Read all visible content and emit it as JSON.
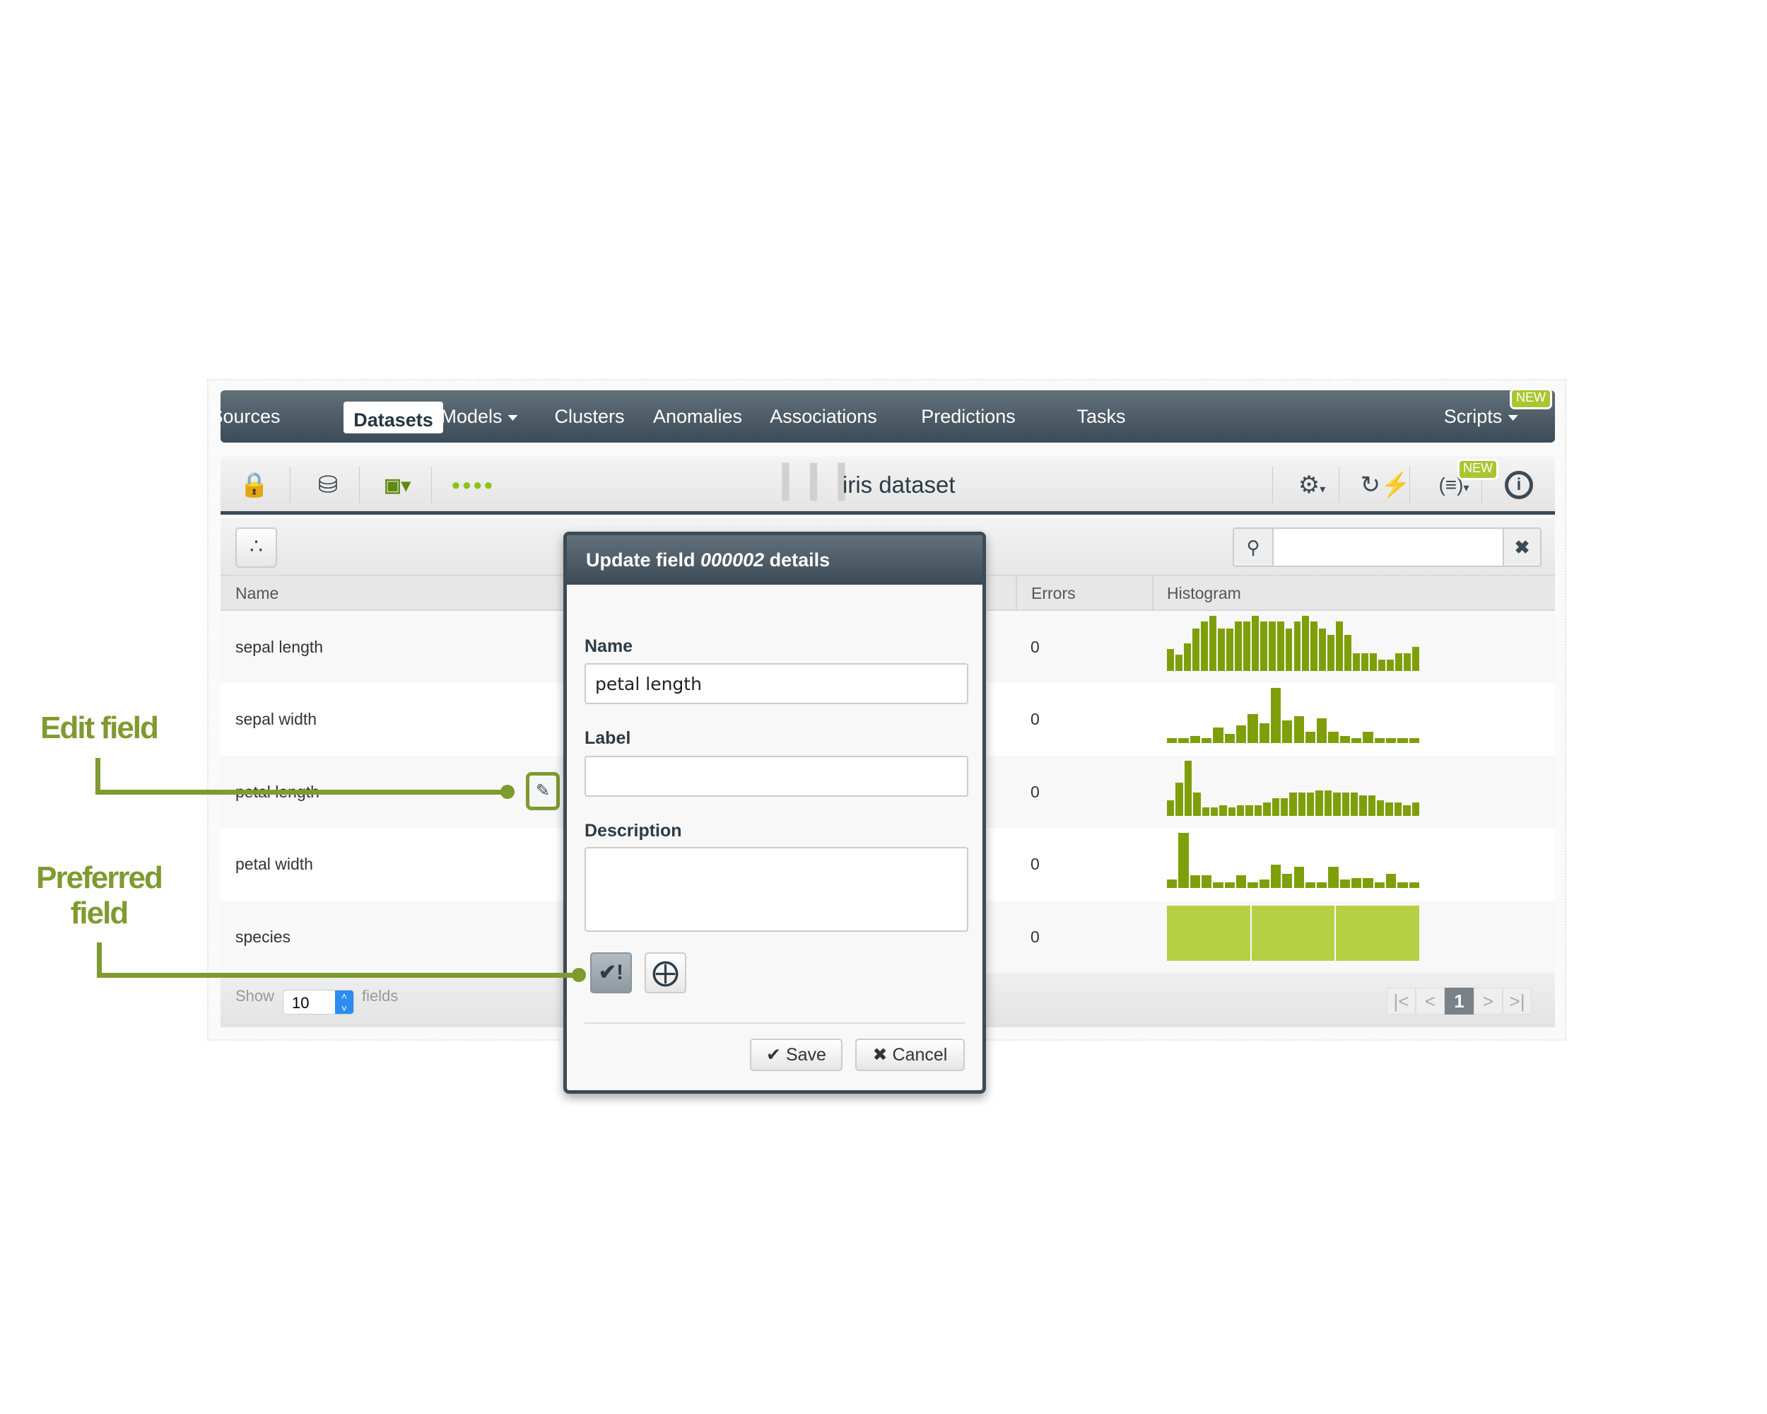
{
  "nav": {
    "items": [
      {
        "label": "Sources"
      },
      {
        "label": "Datasets",
        "active": true
      },
      {
        "label": "Models",
        "dropdown": true
      },
      {
        "label": "Clusters"
      },
      {
        "label": "Anomalies"
      },
      {
        "label": "Associations"
      },
      {
        "label": "Predictions"
      },
      {
        "label": "Tasks"
      },
      {
        "label": "Scripts",
        "dropdown": true
      }
    ],
    "new_badge": "NEW"
  },
  "toolbar": {
    "title": "iris dataset",
    "new_badge": "NEW",
    "icons": [
      "lock-icon",
      "database-search-icon",
      "sort-numbers-icon",
      "dots-icon",
      "gear-icon",
      "lightning-cycle-icon",
      "script-icon",
      "info-icon"
    ]
  },
  "search": {
    "value": "",
    "placeholder": ""
  },
  "table": {
    "headers": {
      "name": "Name",
      "errors": "Errors",
      "histogram": "Histogram"
    },
    "rows": [
      {
        "name": "sepal length",
        "errors": "0"
      },
      {
        "name": "sepal width",
        "errors": "0"
      },
      {
        "name": "petal length",
        "errors": "0"
      },
      {
        "name": "petal width",
        "errors": "0"
      },
      {
        "name": "species",
        "errors": "0"
      }
    ]
  },
  "histograms": [
    [
      0.4,
      0.3,
      0.5,
      0.77,
      0.9,
      1,
      0.77,
      0.77,
      0.9,
      0.9,
      1,
      0.9,
      0.9,
      0.9,
      0.77,
      0.9,
      1,
      0.9,
      0.77,
      0.66,
      0.9,
      0.66,
      0.32,
      0.32,
      0.32,
      0.21,
      0.21,
      0.32,
      0.32,
      0.44
    ],
    [
      0.1,
      0.1,
      0.13,
      0.1,
      0.29,
      0.17,
      0.33,
      0.53,
      0.37,
      1,
      0.41,
      0.49,
      0.21,
      0.45,
      0.21,
      0.13,
      0.1,
      0.21,
      0.1,
      0.1,
      0.1,
      0.1
    ],
    [
      0.28,
      0.6,
      1,
      0.42,
      0.15,
      0.15,
      0.19,
      0.15,
      0.19,
      0.19,
      0.19,
      0.24,
      0.32,
      0.32,
      0.42,
      0.42,
      0.42,
      0.46,
      0.46,
      0.42,
      0.42,
      0.42,
      0.37,
      0.37,
      0.28,
      0.24,
      0.24,
      0.19,
      0.24
    ],
    [
      0.15,
      1,
      0.23,
      0.23,
      0.1,
      0.1,
      0.23,
      0.1,
      0.15,
      0.43,
      0.26,
      0.39,
      0.11,
      0.1,
      0.39,
      0.15,
      0.18,
      0.18,
      0.1,
      0.26,
      0.1,
      0.1
    ],
    [
      1,
      1,
      1
    ]
  ],
  "colors": {
    "bar": "#7f9f0a",
    "categorical": "#b5d045",
    "accent": "#7f9a2f",
    "nav": "#3c4b56"
  },
  "footer": {
    "show": "Show",
    "per_page": "10",
    "fields": "fields",
    "current_page": "1"
  },
  "dialog": {
    "title_prefix": "Update field ",
    "field_id": "000002",
    "title_suffix": " details",
    "name_label": "Name",
    "name_value": "petal length",
    "label_label": "Label",
    "label_value": "",
    "description_label": "Description",
    "description_value": "",
    "save": "Save",
    "cancel": "Cancel",
    "preferred_active": true
  },
  "annotations": {
    "edit": "Edit field",
    "preferred": "Preferred field"
  }
}
